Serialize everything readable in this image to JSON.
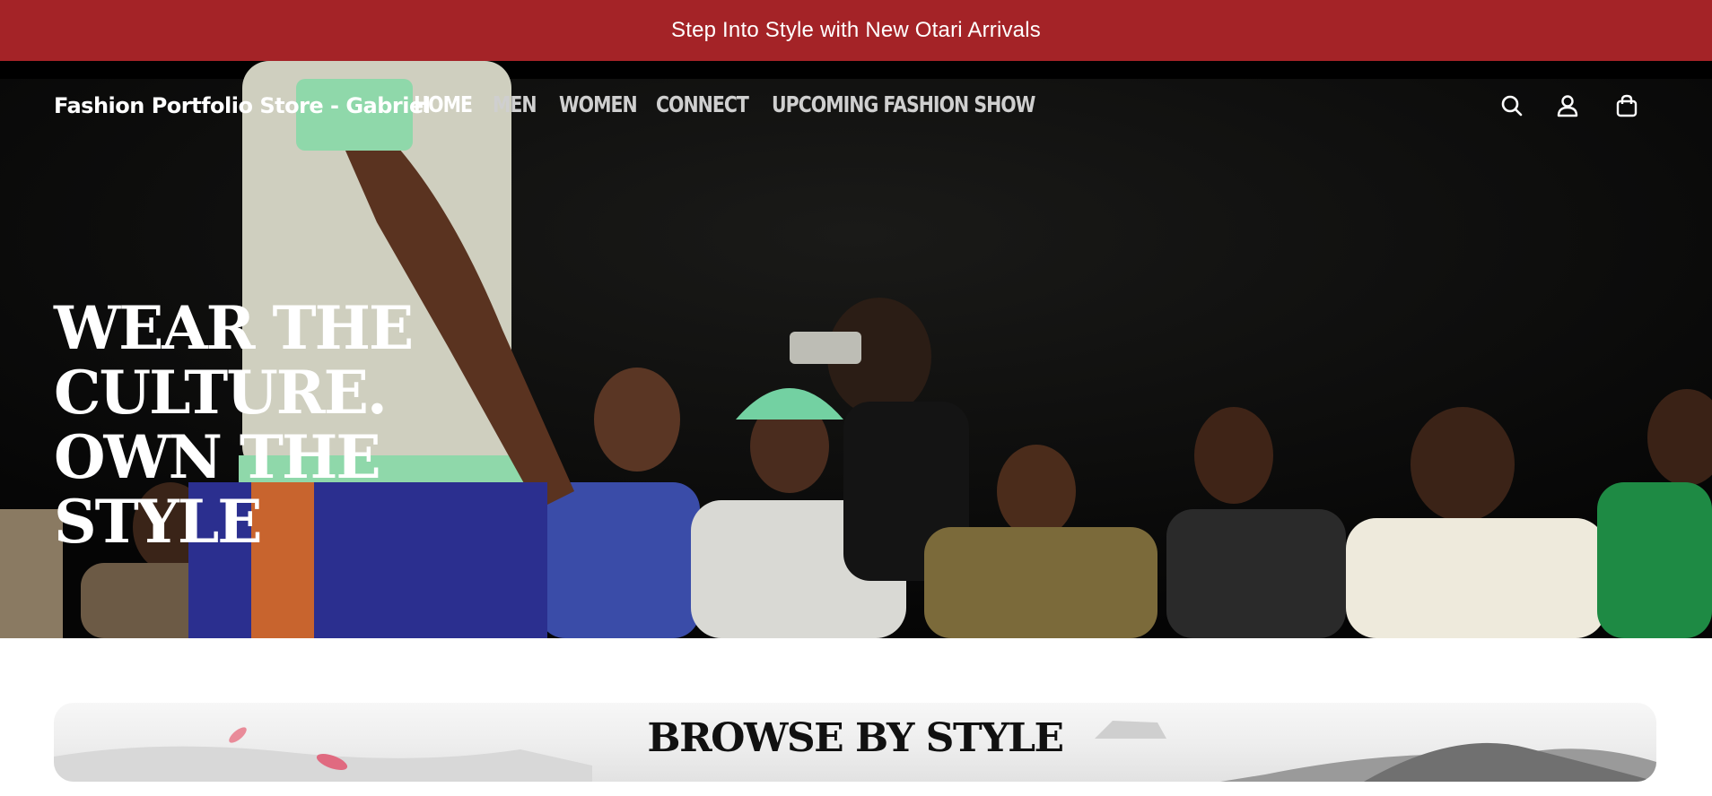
{
  "announcement": {
    "text": "Step Into Style with New Otari Arrivals"
  },
  "header": {
    "logo": "Fashion Portfolio Store - Gabriel",
    "nav": [
      "HOME",
      "MEN",
      "WOMEN",
      "CONNECT",
      "UPCOMING FASHION SHOW"
    ],
    "active_nav": "HOME",
    "icons": [
      "search-icon",
      "account-icon",
      "cart-icon"
    ]
  },
  "hero": {
    "title": "WEAR THE CULTURE. OWN THE STYLE"
  },
  "browse": {
    "title": "BROWSE BY STYLE"
  },
  "colors": {
    "announcement_bg": "#a42327",
    "hero_bg": "#0a0a0a",
    "text_light": "#ffffff",
    "nav_inactive": "#cfcfcf"
  }
}
